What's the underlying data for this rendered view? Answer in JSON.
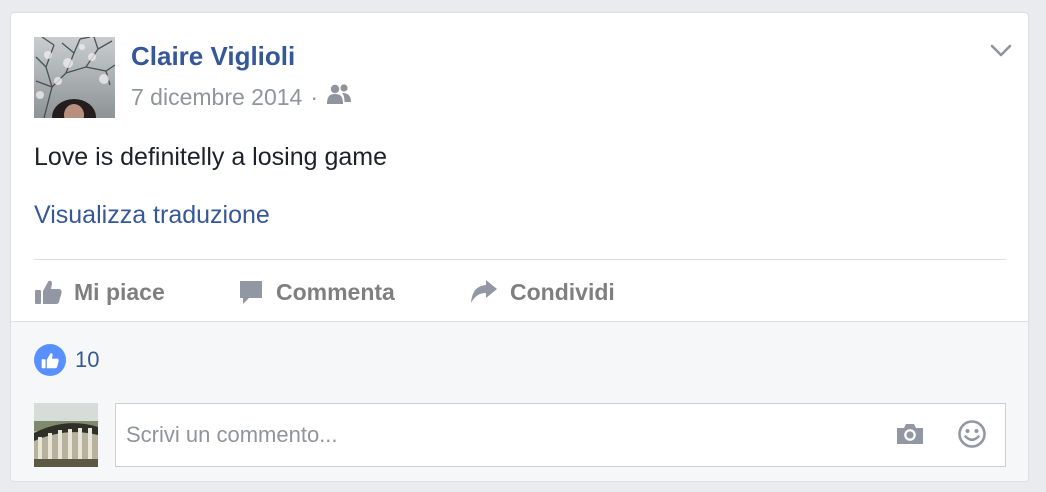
{
  "post": {
    "author": "Claire Viglioli",
    "date": "7 dicembre 2014",
    "separator": "·",
    "audience_icon": "friends-icon",
    "text": "Love is definitelly a losing game",
    "translate_link": "Visualizza traduzione",
    "options_icon": "chevron-down-icon"
  },
  "actions": {
    "like_label": "Mi piace",
    "comment_label": "Commenta",
    "share_label": "Condividi"
  },
  "reactions": {
    "like_count": "10"
  },
  "composer": {
    "placeholder": "Scrivi un commento...",
    "camera_icon": "camera-icon",
    "emoji_icon": "smiley-icon"
  },
  "colors": {
    "link_blue": "#365899",
    "like_badge": "#5890ff",
    "muted_text": "#90949c",
    "action_gray": "#7f7f7f",
    "page_bg": "#e9ebee",
    "footer_bg": "#f6f7f9"
  }
}
